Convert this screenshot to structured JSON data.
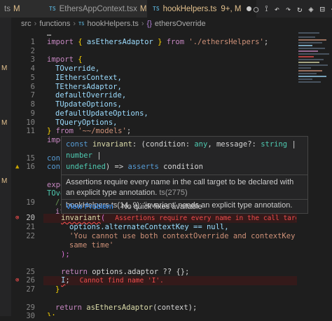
{
  "tabs": [
    {
      "label": "ts",
      "modified": "M",
      "active": false
    },
    {
      "label": "EthersAppContext.tsx",
      "modified": "M",
      "active": false
    },
    {
      "label": "hookHelpers.ts",
      "modified": "9+, M",
      "active": true
    }
  ],
  "actions": [
    "○",
    "⟟",
    "↶",
    "↷",
    "↻",
    "◈",
    "⊟",
    "⋯"
  ],
  "breadcrumb": {
    "parts": [
      "src",
      "functions",
      "hookHelpers.ts",
      "ethersOverride"
    ],
    "file_icon": "TS",
    "fn_icon": "{}"
  },
  "left_markers": [
    "M",
    "M",
    "M"
  ],
  "gutter": {
    "lines": [
      "",
      "1",
      "2",
      "3",
      "4",
      "5",
      "6",
      "7",
      "8",
      "9",
      "10",
      "11",
      "",
      "",
      "15",
      "16",
      "",
      "",
      "19",
      "20",
      "21",
      "22",
      "",
      "",
      "25",
      "26",
      "27",
      "",
      "29",
      "30"
    ]
  },
  "code": {
    "l0": "…",
    "l1_kw": "import",
    "l1_brace": "{ ",
    "l1_id": "asEthersAdaptor",
    "l1_brace2": " }",
    "l1_from": " from ",
    "l1_str": "'./ethersHelpers'",
    "l1_end": ";",
    "l3_kw": "import",
    "l3_brace": " {",
    "l4": "TOverride,",
    "l5": "IEthersContext,",
    "l6": "TEthersAdaptor,",
    "l7": "defaultOverride,",
    "l8": "TUpdateOptions,",
    "l9": "defaultUpdateOptions,",
    "l10": "TQueryOptions,",
    "l11_brace": "}",
    "l11_from": " from ",
    "l11_str": "'~~/models'",
    "l11_end": ";",
    "l12": "impo",
    "l14": "cons",
    "l15": "cons",
    "l17": "expo",
    "l18": "TOve",
    "l19": "//",
    "l20_if": "if",
    "l21_fn": "invariant",
    "l21_paren": "(",
    "l21_err": "Assertions require every name in the call target to be dec",
    "l22": "options.alternateContextKey == null,",
    "l23": "'You cannot use both contextOverride and contextKey at the",
    "l24": "same time'",
    "l25": ");",
    "l27_ret": "return",
    "l27_rest": " options.adaptor ?? {};",
    "l28_i": "I",
    "l28_semi": ";",
    "l28_err": "Cannot find name 'I'.",
    "l29": "}",
    "l31_ret": "return",
    "l31_fn": " asEthersAdaptor",
    "l31_rest": "(context);",
    "l32": "};"
  },
  "hover": {
    "sig_kw": "const",
    "sig_name": "invariant",
    "sig_rest": ": (condition: ",
    "sig_any": "any",
    "sig_mid": ", message?: ",
    "sig_string": "string",
    "sig_bar": " | ",
    "sig_number": "number",
    "sig_bar2": " |",
    "sig_line2_undef": "undefined",
    "sig_line2_rest": ") => ",
    "sig_asserts": "asserts",
    "sig_cond": " condition",
    "msg1": "Assertions require every name in the call target to be declared with an explicit type annotation.",
    "msg1_code": "ts(2775)",
    "msg2": "hookHelpers.ts(14, 9): 'invariant' needs an explicit type annotation.",
    "view_problem": "View Problem",
    "no_fixes": "No quick fixes available"
  },
  "colors": {
    "error": "#f14c4c",
    "warning": "#cca700",
    "modified": "#e2c08d",
    "link": "#3794ff"
  }
}
